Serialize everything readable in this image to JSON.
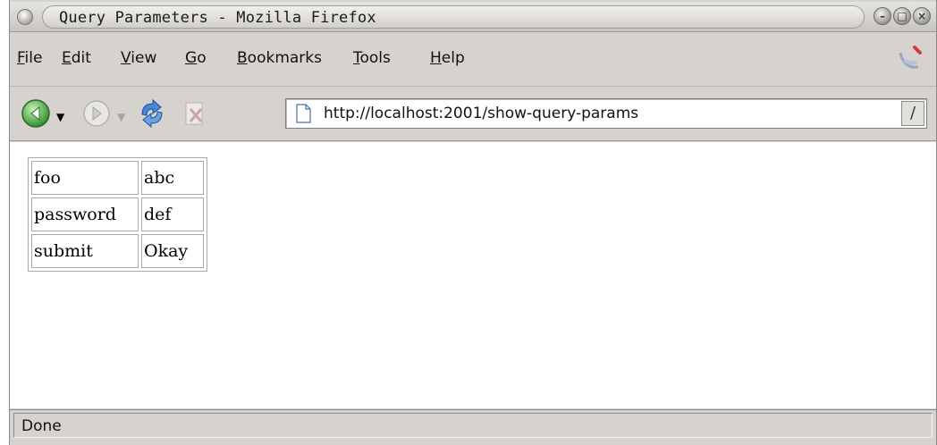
{
  "window": {
    "title": "Query Parameters - Mozilla Firefox",
    "controls": {
      "minimize": "–",
      "maximize": "□",
      "close": "×"
    }
  },
  "menu": [
    {
      "label": "File",
      "accel": "F",
      "rest": "ile"
    },
    {
      "label": "Edit",
      "accel": "E",
      "rest": "dit"
    },
    {
      "label": "View",
      "accel": "V",
      "rest": "iew"
    },
    {
      "label": "Go",
      "accel": "G",
      "rest": "o"
    },
    {
      "label": "Bookmarks",
      "accel": "B",
      "rest": "ookmarks"
    },
    {
      "label": "Tools",
      "accel": "T",
      "rest": "ools"
    },
    {
      "label": "Help",
      "accel": "H",
      "rest": "elp"
    }
  ],
  "toolbar": {
    "icons": [
      "back-icon",
      "forward-icon",
      "reload-icon",
      "stop-icon",
      "page-icon",
      "go-icon"
    ],
    "url": "http://localhost:2001/show-query-params",
    "go_glyph": "/"
  },
  "params": [
    {
      "name": "foo",
      "value": "abc"
    },
    {
      "name": "password",
      "value": "def"
    },
    {
      "name": "submit",
      "value": "Okay"
    }
  ],
  "status": {
    "text": "Done"
  },
  "colors": {
    "chrome": "#d6d3ce",
    "back_green": "#3aa63a",
    "content": "#ffffff"
  }
}
